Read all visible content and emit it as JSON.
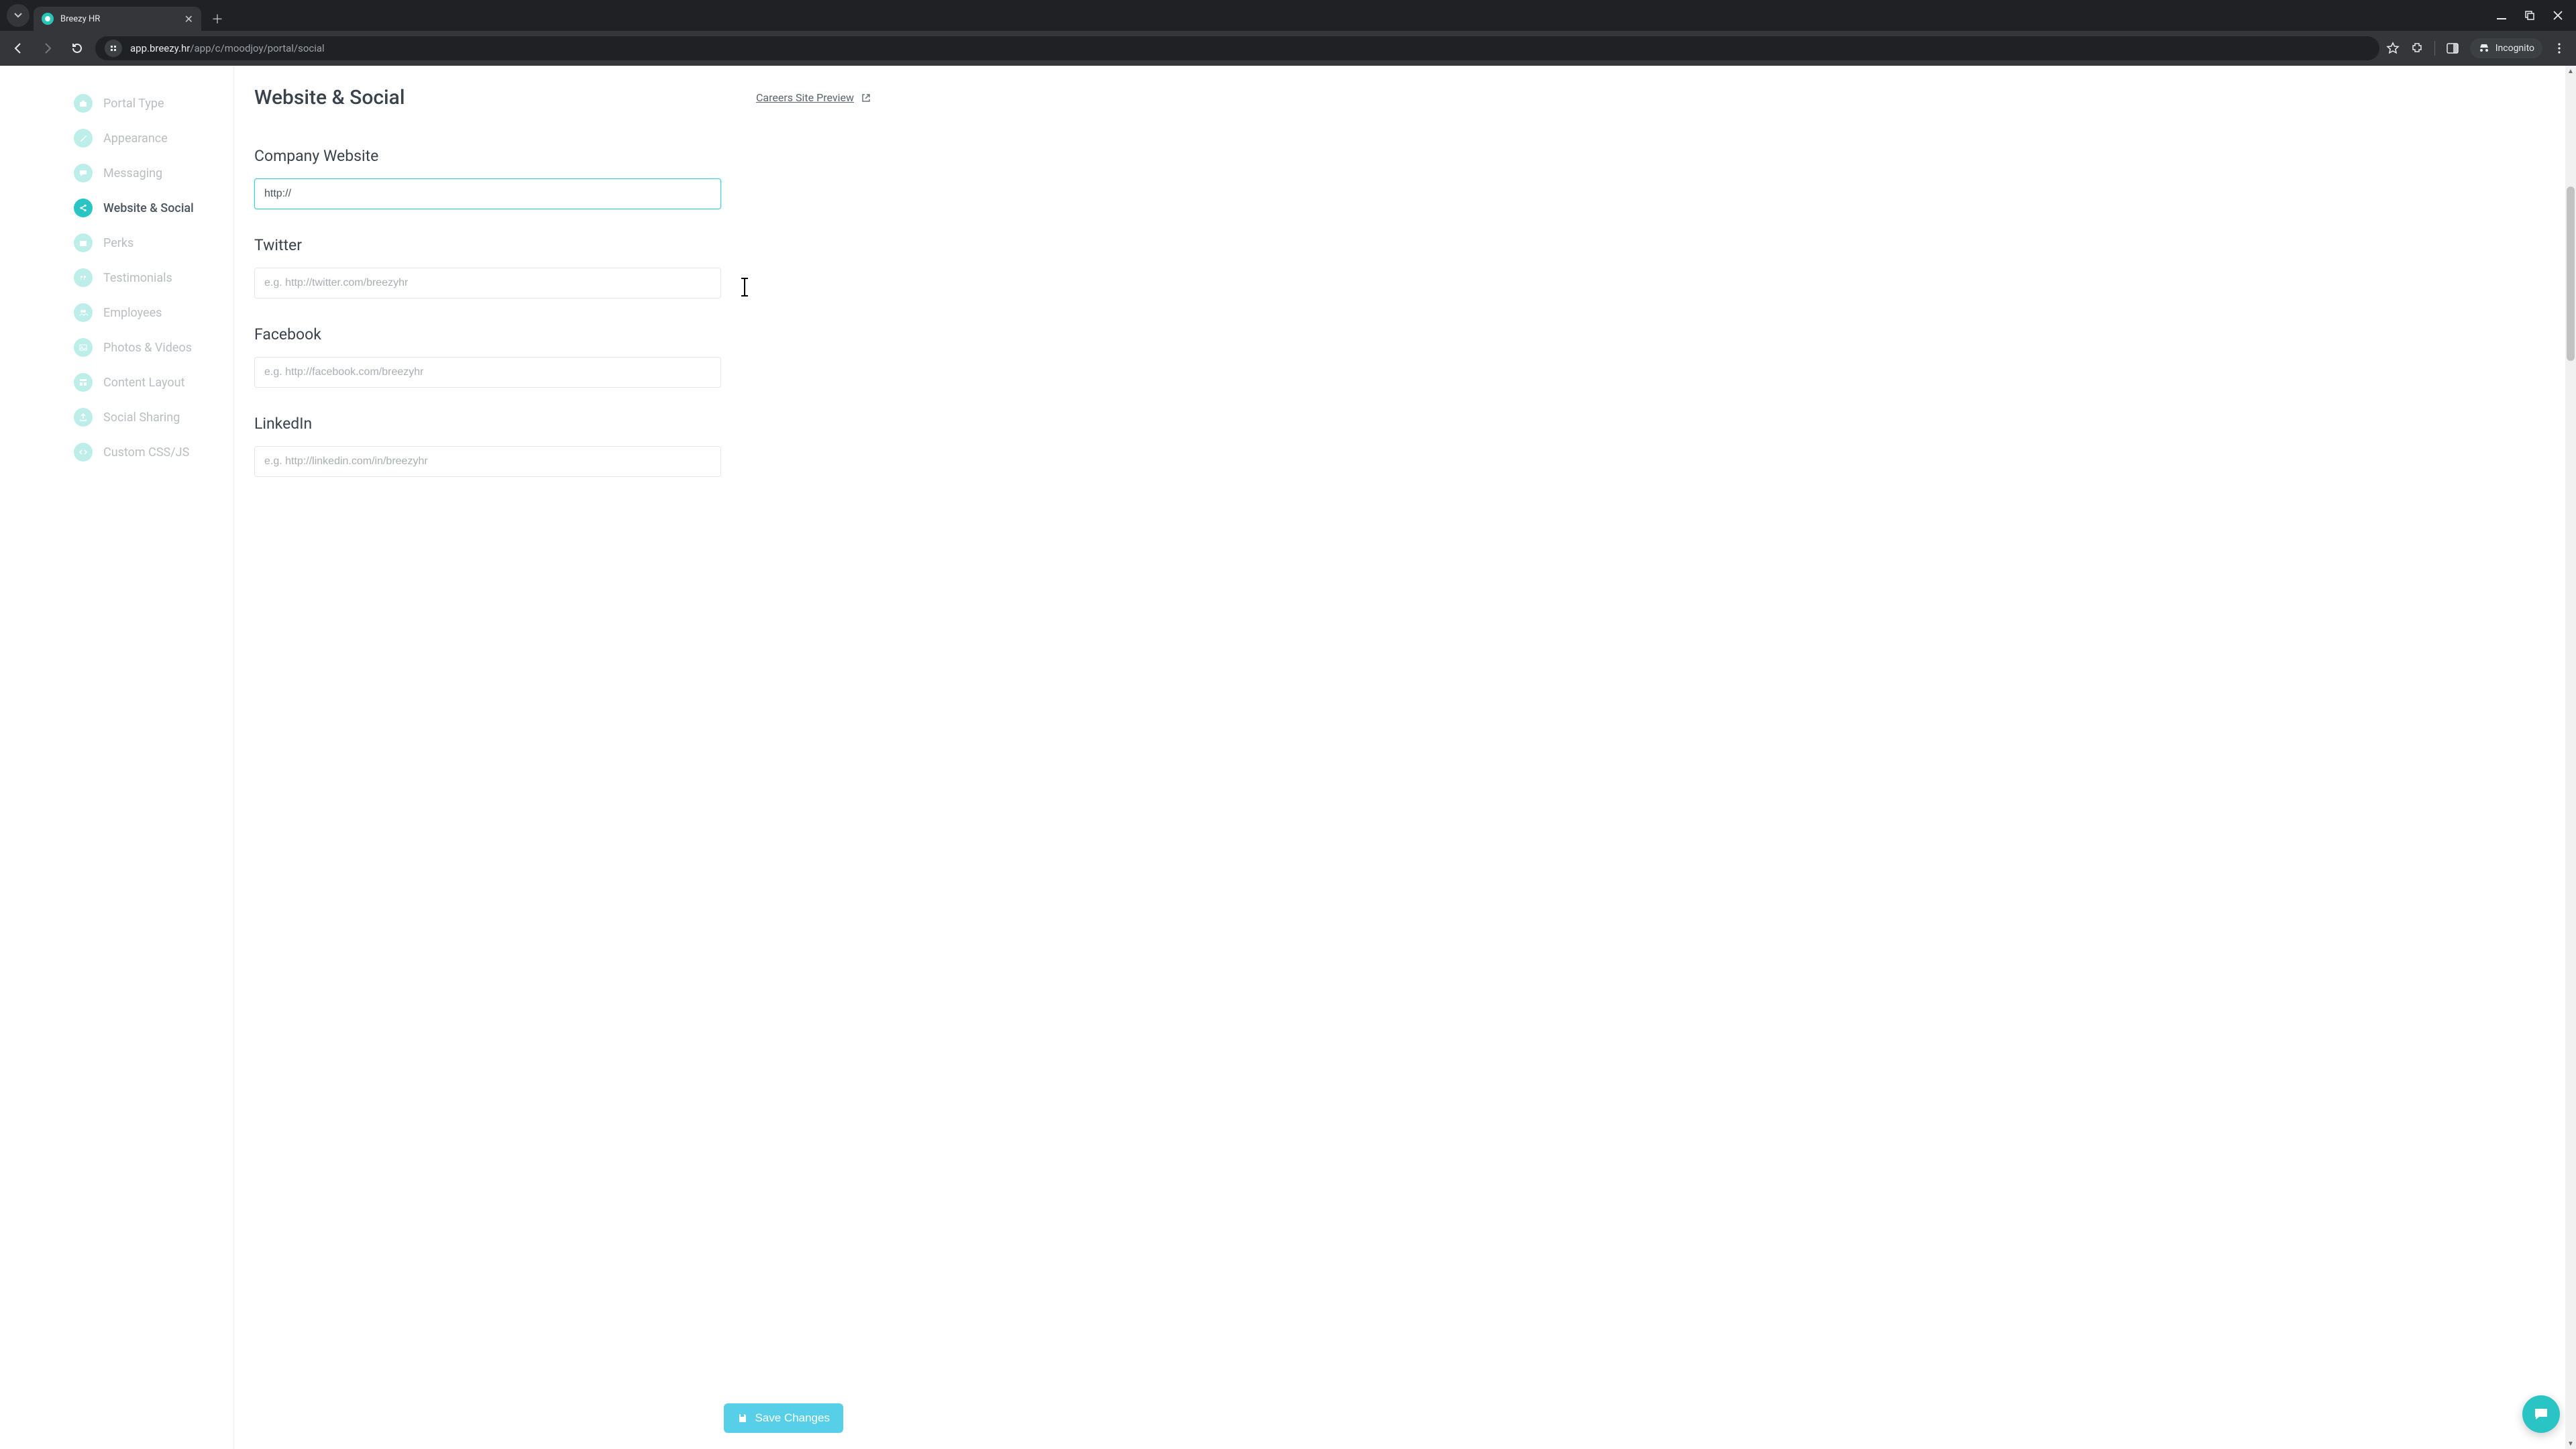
{
  "browser": {
    "tab_title": "Breezy HR",
    "url_host": "app.breezy.hr",
    "url_path": "/app/c/moodjoy/portal/social",
    "incognito_label": "Incognito"
  },
  "sidebar": {
    "items": [
      {
        "label": "Portal Type",
        "icon": "briefcase-icon"
      },
      {
        "label": "Appearance",
        "icon": "brush-icon"
      },
      {
        "label": "Messaging",
        "icon": "chat-icon"
      },
      {
        "label": "Website & Social",
        "icon": "share-icon"
      },
      {
        "label": "Perks",
        "icon": "gift-icon"
      },
      {
        "label": "Testimonials",
        "icon": "quote-icon"
      },
      {
        "label": "Employees",
        "icon": "people-icon"
      },
      {
        "label": "Photos & Videos",
        "icon": "photo-icon"
      },
      {
        "label": "Content Layout",
        "icon": "layout-icon"
      },
      {
        "label": "Social Sharing",
        "icon": "share-alt-icon"
      },
      {
        "label": "Custom CSS/JS",
        "icon": "code-icon"
      }
    ],
    "active_index": 3
  },
  "main": {
    "title": "Website & Social",
    "preview_label": "Careers Site Preview",
    "fields": {
      "company_website": {
        "label": "Company Website",
        "value": "http://",
        "placeholder": ""
      },
      "twitter": {
        "label": "Twitter",
        "value": "",
        "placeholder": "e.g. http://twitter.com/breezyhr"
      },
      "facebook": {
        "label": "Facebook",
        "value": "",
        "placeholder": "e.g. http://facebook.com/breezyhr"
      },
      "linkedin": {
        "label": "LinkedIn",
        "value": "",
        "placeholder": "e.g. http://linkedin.com/in/breezyhr"
      }
    },
    "save_label": "Save Changes"
  },
  "colors": {
    "accent": "#2ac4c4",
    "accent_light": "#bdeeea",
    "save_button": "#58cfe8"
  }
}
